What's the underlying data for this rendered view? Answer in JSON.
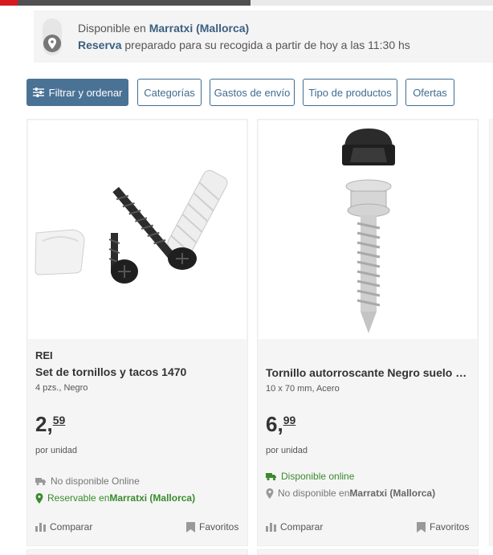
{
  "store": {
    "line1_prefix": "Disponible en",
    "line1_store": "Marratxi (Mallorca)",
    "line2_link": "Reserva",
    "line2_rest": " preparado para su recogida a partir de hoy a las 11:30 hs"
  },
  "filters": {
    "filter_sort": "Filtrar y ordenar",
    "categories": "Categorías",
    "shipping": "Gastos de envío",
    "product_type": "Tipo de productos",
    "offers": "Ofertas"
  },
  "products": [
    {
      "brand": "REI",
      "title": "Set de tornillos y tacos 1470",
      "subtitle": "4 pzs., Negro",
      "price_int": "2,",
      "price_dec": "59",
      "unit": "por unidad",
      "online_status": "No disponible Online",
      "store_prefix": "Reservable en ",
      "store_name": "Marratxi (Mallorca)",
      "compare": "Comparar",
      "favorites": "Favoritos"
    },
    {
      "brand": "",
      "title": "Tornillo autorroscante Negro suelo de ...",
      "subtitle": "10 x 70 mm, Acero",
      "price_int": "6,",
      "price_dec": "99",
      "unit": "por unidad",
      "online_status": "Disponible online",
      "store_prefix": "No disponible en ",
      "store_name": "Marratxi (Mallorca)",
      "compare": "Comparar",
      "favorites": "Favoritos"
    }
  ],
  "icons": {
    "pin": "location-pin-icon",
    "filter": "sliders-icon",
    "truck": "truck-icon",
    "compare": "bar-chart-icon",
    "favorite": "bookmark-icon"
  },
  "colors": {
    "brand_red": "#d71920",
    "accent_blue": "#4a7295",
    "available_green": "#3a8a2e"
  }
}
